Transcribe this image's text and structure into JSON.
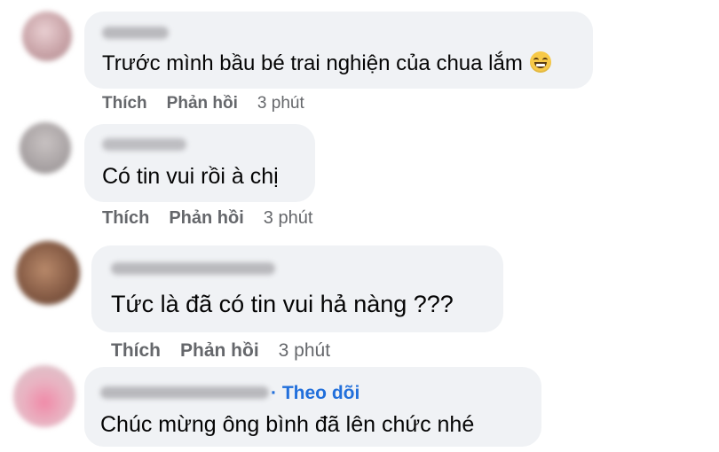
{
  "comments": [
    {
      "text": "Trước mình bầu bé trai nghiện của chua lắm",
      "actions": {
        "like": "Thích",
        "reply": "Phản hồi",
        "time": "3 phút"
      },
      "emoji": "laughing-face-icon"
    },
    {
      "text": "Có tin vui rồi à chị",
      "actions": {
        "like": "Thích",
        "reply": "Phản hồi",
        "time": "3 phút"
      }
    },
    {
      "text": "Tức là đã có tin vui hả nàng ???",
      "actions": {
        "like": "Thích",
        "reply": "Phản hồi",
        "time": "3 phút"
      }
    },
    {
      "text": "Chúc mừng ông bình đã lên chức nhé",
      "follow": "· Theo dõi"
    }
  ],
  "colors": {
    "bubble": "#f0f2f5",
    "action_text": "#65676b",
    "follow_link": "#216fdb"
  }
}
